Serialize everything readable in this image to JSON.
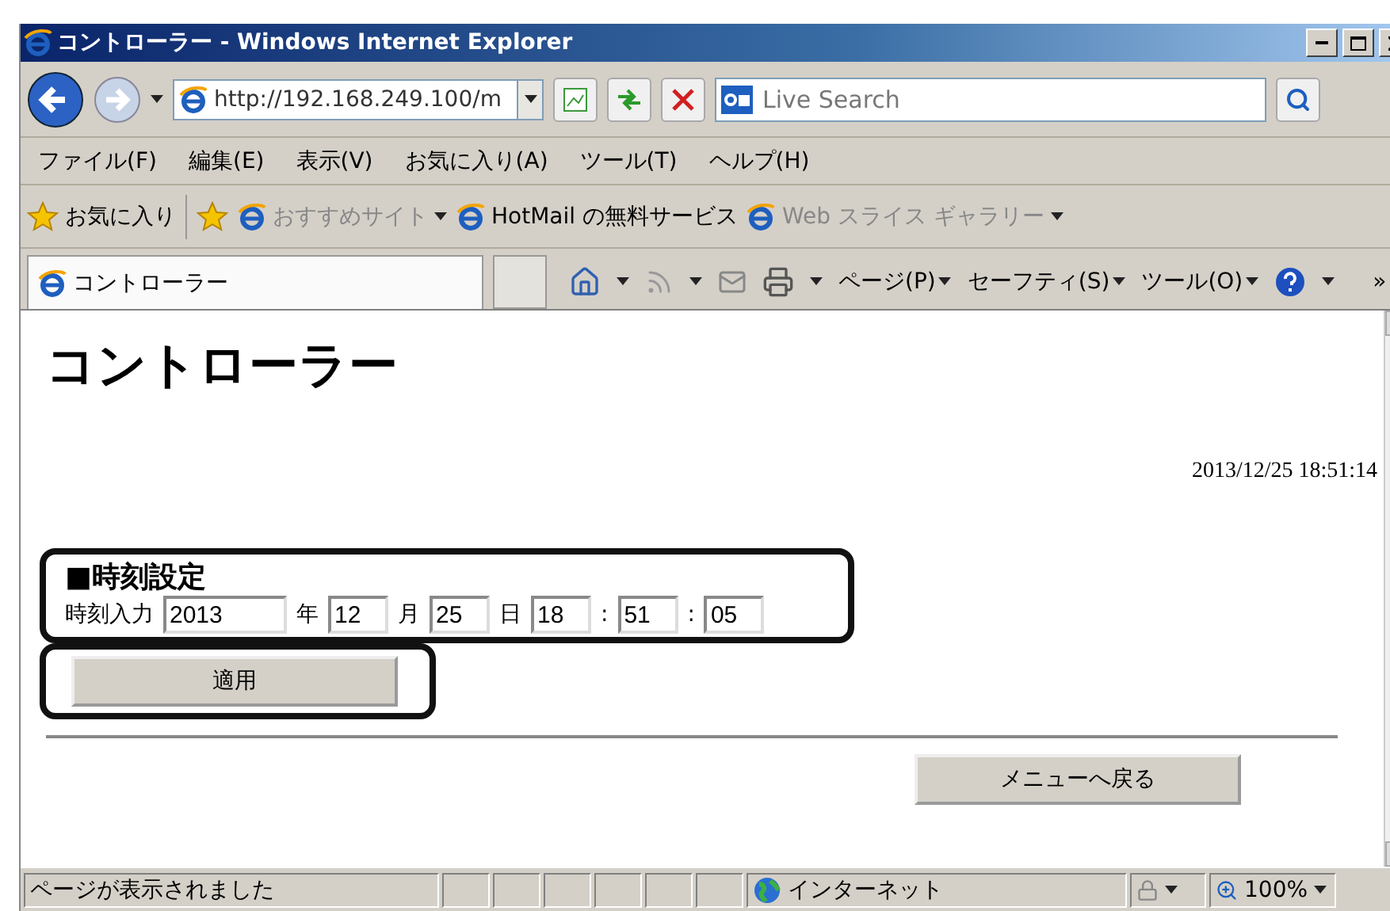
{
  "window": {
    "title": "コントローラー - Windows Internet Explorer"
  },
  "address_bar": {
    "value": "http://192.168.249.100/m"
  },
  "search": {
    "placeholder": "Live Search"
  },
  "menu": [
    "ファイル(F)",
    "編集(E)",
    "表示(V)",
    "お気に入り(A)",
    "ツール(T)",
    "ヘルプ(H)"
  ],
  "favorites_bar": {
    "label": "お気に入り",
    "links": [
      {
        "label": "おすすめサイト",
        "disabled": true,
        "dropdown": true
      },
      {
        "label": "HotMail の無料サービス",
        "disabled": false,
        "dropdown": false
      },
      {
        "label": "Web スライス ギャラリー",
        "disabled": true,
        "dropdown": true
      }
    ]
  },
  "tab": {
    "label": "コントローラー"
  },
  "command_bar": [
    "ページ(P)",
    "セーフティ(S)",
    "ツール(O)"
  ],
  "command_overflow": "»",
  "page": {
    "heading": "コントローラー",
    "datetime": "2013/12/25 18:51:14",
    "section_title": "■時刻設定",
    "input_label": "時刻入力",
    "fields": [
      {
        "value": "2013",
        "unit": "年",
        "kind": "wide"
      },
      {
        "value": "12",
        "unit": "月",
        "kind": "narrow"
      },
      {
        "value": "25",
        "unit": "日",
        "kind": "narrow"
      },
      {
        "value": "18",
        "unit": ":",
        "kind": "narrow"
      },
      {
        "value": "51",
        "unit": ":",
        "kind": "narrow"
      },
      {
        "value": "05",
        "kind": "narrow"
      }
    ],
    "apply_button": "適用",
    "back_button": "メニューへ戻る"
  },
  "status_bar": {
    "text": "ページが表示されました",
    "zone": "インターネット",
    "zoom": "100%"
  }
}
